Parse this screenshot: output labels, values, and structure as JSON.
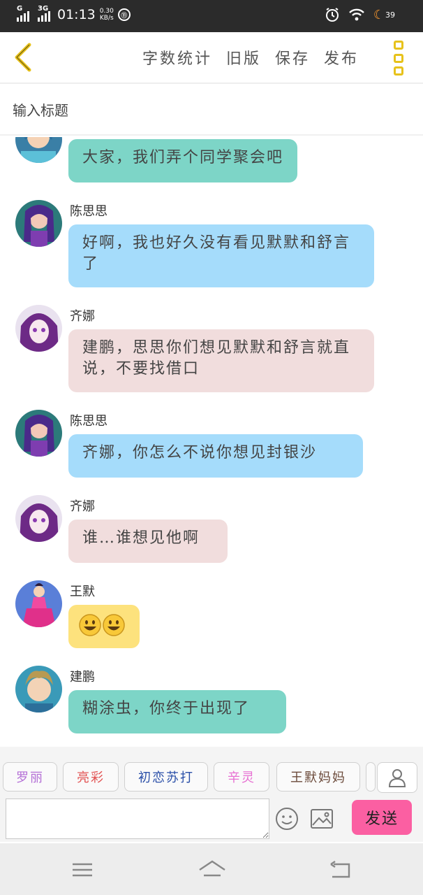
{
  "status_bar": {
    "signal1_label": "G",
    "signal2_label": "3G",
    "time": "01:13",
    "speed_value": "0.30",
    "speed_unit": "KB/s",
    "data_icon_label": "⑪",
    "battery": "39"
  },
  "toolbar": {
    "word_count": "字数统计",
    "old_version": "旧版",
    "save": "保存",
    "publish": "发布"
  },
  "title_input": {
    "placeholder": "输入标题"
  },
  "messages": [
    {
      "name": "",
      "text": "大家，我们弄个同学聚会吧",
      "color": "#7dd5c7"
    },
    {
      "name": "陈思思",
      "text": "好啊，我也好久没有看见默默和舒言了",
      "color": "#a5dcfb"
    },
    {
      "name": "齐娜",
      "text": "建鹏，思思你们想见默默和舒言就直说，不要找借口",
      "color": "#f1dddd"
    },
    {
      "name": "陈思思",
      "text": "齐娜，你怎么不说你想见封银沙",
      "color": "#a5dcfb"
    },
    {
      "name": "齐娜",
      "text": "谁…谁想见他啊",
      "color": "#f1dddd"
    },
    {
      "name": "王默",
      "text": "",
      "color": "#fde27d"
    },
    {
      "name": "建鹏",
      "text": "糊涂虫，你终于出现了",
      "color": "#7dd5c7"
    }
  ],
  "characters": [
    {
      "label": "罗丽",
      "color": "#b46fd6"
    },
    {
      "label": "亮彩",
      "color": "#e25252"
    },
    {
      "label": "初恋苏打",
      "color": "#2a4fa8"
    },
    {
      "label": "辛灵",
      "color": "#e76fd2"
    },
    {
      "label": "王默妈妈",
      "color": "#6b4a3a"
    }
  ],
  "composer": {
    "send_label": "发送"
  },
  "icons": {
    "back": "chevron-left-icon",
    "menu": "more-icon",
    "person": "person-icon",
    "emoji": "smile-icon",
    "image": "image-icon",
    "nav_menu": "hamburger-icon",
    "nav_home": "home-icon",
    "nav_back": "return-icon"
  },
  "colors": {
    "accent": "#e7c21b",
    "send": "#fb5fa2"
  }
}
